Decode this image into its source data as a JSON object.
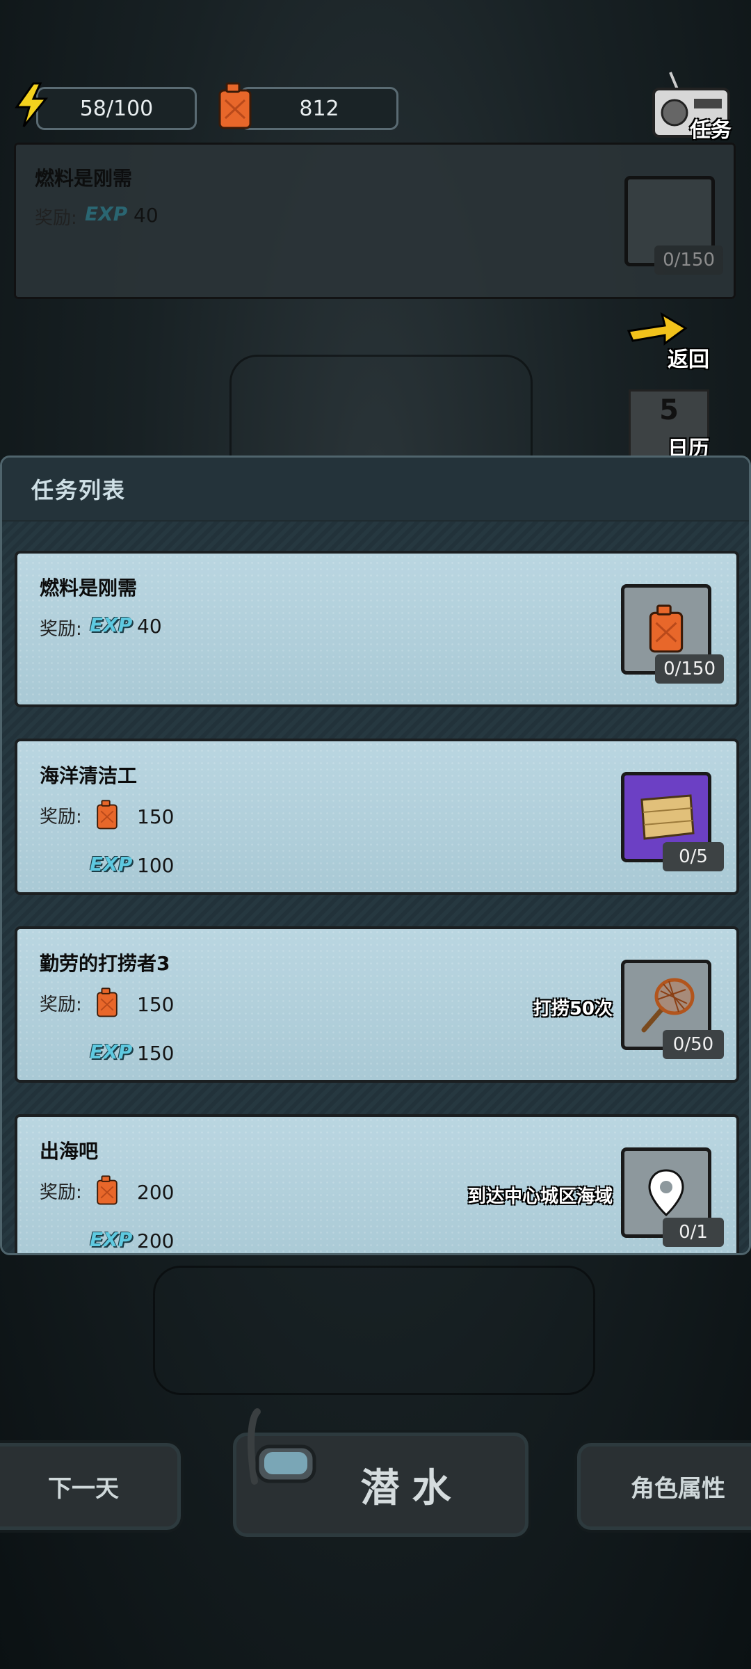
{
  "resources": {
    "energy": "58/100",
    "fuel": "812"
  },
  "header": {
    "tasks_label": "任务",
    "return_label": "返回",
    "calendar_day": "5",
    "calendar_label": "日历"
  },
  "top_card": {
    "title": "燃料是刚需",
    "reward_label": "奖励:",
    "exp_tag": "EXP",
    "exp_value": "40",
    "progress": "0/150"
  },
  "panel": {
    "title": "任务列表"
  },
  "quests": [
    {
      "title": "燃料是刚需",
      "reward_label": "奖励:",
      "exp_tag": "EXP",
      "exp_value": "40",
      "progress": "0/150"
    },
    {
      "title": "海洋清洁工",
      "reward_label": "奖励:",
      "fuel_value": "150",
      "exp_tag": "EXP",
      "exp_value": "100",
      "progress": "0/5"
    },
    {
      "title": "勤劳的打捞者3",
      "reward_label": "奖励:",
      "fuel_value": "150",
      "exp_tag": "EXP",
      "exp_value": "150",
      "goal": "打捞50次",
      "progress": "0/50"
    },
    {
      "title": "出海吧",
      "reward_label": "奖励:",
      "fuel_value": "200",
      "exp_tag": "EXP",
      "exp_value": "200",
      "goal": "到达中心城区海域",
      "progress": "0/1"
    }
  ],
  "bottom": {
    "next_day": "下一天",
    "dive": "潜水",
    "attributes": "角色属性"
  },
  "icons": {
    "energy": "lightning-icon",
    "fuel": "jerrycan-icon",
    "tasks": "radio-icon",
    "return": "arrow-icon",
    "calendar": "calendar-icon",
    "plank": "wood-plank-icon",
    "net": "fishing-net-icon",
    "location": "location-pin-icon",
    "dive": "diving-mask-icon"
  },
  "colors": {
    "card": "#b3d0db",
    "exp": "#5ec9e0",
    "fuel": "#e8672a",
    "purple_slot": "#6c40c4"
  }
}
